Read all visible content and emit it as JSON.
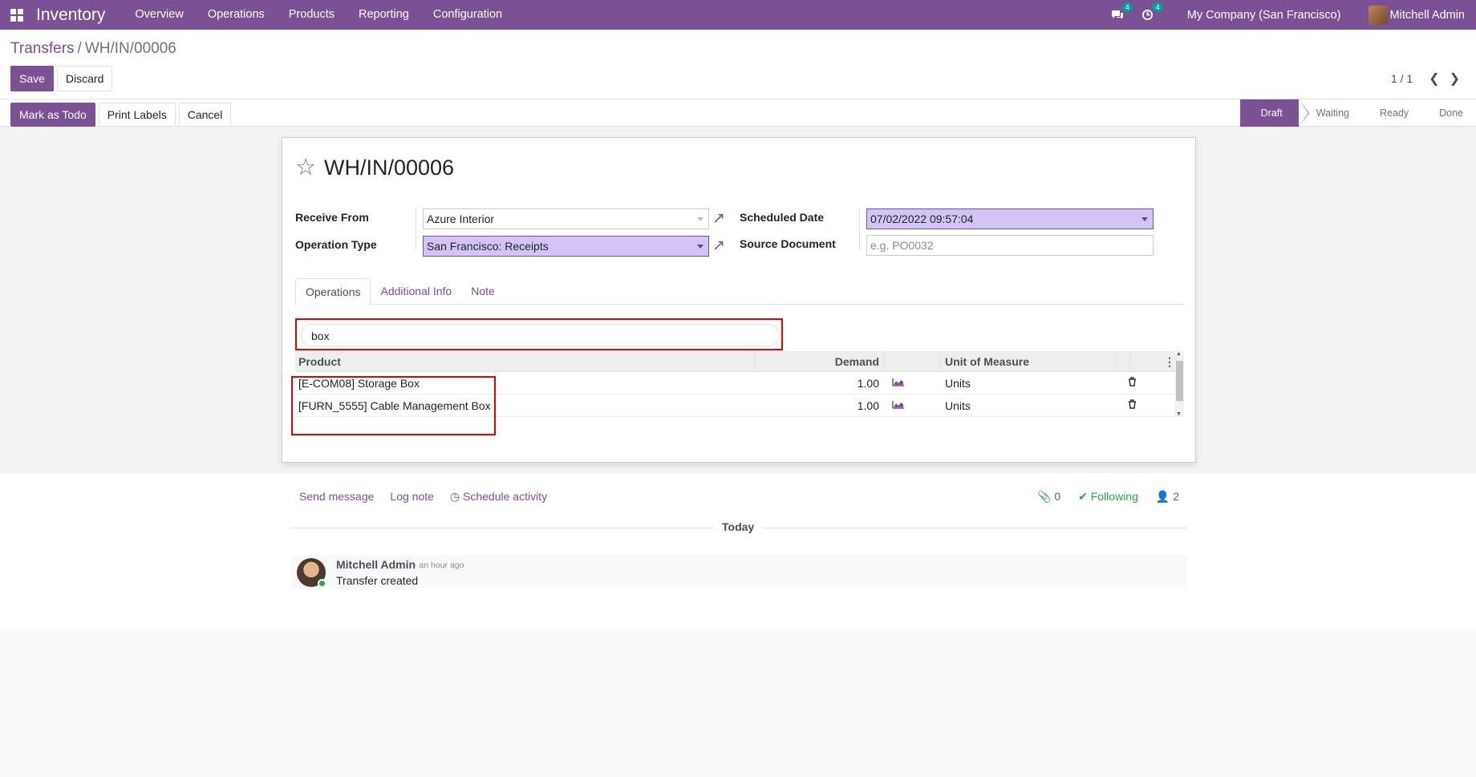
{
  "navbar": {
    "app_title": "Inventory",
    "menu": [
      "Overview",
      "Operations",
      "Products",
      "Reporting",
      "Configuration"
    ],
    "messages_badge": "4",
    "activities_badge": "4",
    "company": "My Company (San Francisco)",
    "user": "Mitchell Admin"
  },
  "breadcrumb": {
    "parent": "Transfers",
    "separator": "/",
    "current": "WH/IN/00006"
  },
  "buttons": {
    "save": "Save",
    "discard": "Discard",
    "mark_todo": "Mark as Todo",
    "print_labels": "Print Labels",
    "cancel": "Cancel"
  },
  "pager": {
    "value": "1 / 1"
  },
  "statusbar": [
    "Draft",
    "Waiting",
    "Ready",
    "Done"
  ],
  "form": {
    "title": "WH/IN/00006",
    "receive_from_label": "Receive From",
    "receive_from_value": "Azure Interior",
    "operation_type_label": "Operation Type",
    "operation_type_value": "San Francisco: Receipts",
    "scheduled_date_label": "Scheduled Date",
    "scheduled_date_value": "07/02/2022 09:57:04",
    "source_document_label": "Source Document",
    "source_document_placeholder": "e.g. PO0032"
  },
  "tabs": [
    "Operations",
    "Additional Info",
    "Note"
  ],
  "search": {
    "value": "box"
  },
  "table": {
    "headers": {
      "product": "Product",
      "demand": "Demand",
      "uom": "Unit of Measure"
    },
    "rows": [
      {
        "product": "[E-COM08] Storage Box",
        "demand": "1.00",
        "uom": "Units"
      },
      {
        "product": "[FURN_5555] Cable Management Box",
        "demand": "1.00",
        "uom": "Units"
      }
    ]
  },
  "chatter": {
    "send_message": "Send message",
    "log_note": "Log note",
    "schedule_activity": "Schedule activity",
    "attachments": "0",
    "following": "Following",
    "followers": "2",
    "today": "Today",
    "message": {
      "author": "Mitchell Admin",
      "time": "- an hour ago",
      "body": "Transfer created"
    }
  },
  "colors": {
    "brand": "#7c5095",
    "highlight": "#ee0000",
    "required_field": "#d2c5f5"
  },
  "icons": [
    "apps-grid-icon",
    "chat-icon",
    "clock-icon",
    "star-icon",
    "external-link-icon",
    "chart-area-icon",
    "trash-icon",
    "kebab-menu-icon",
    "paperclip-icon",
    "check-icon",
    "user-icon"
  ]
}
